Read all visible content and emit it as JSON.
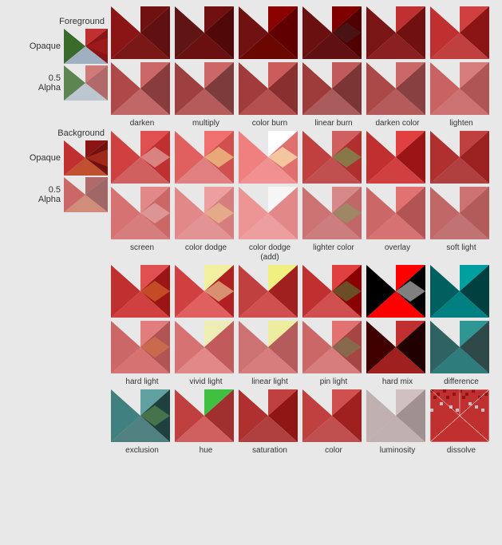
{
  "labels": {
    "foreground": "Foreground",
    "background": "Background",
    "opaque": "Opaque",
    "alpha": "0.5\nAlpha"
  },
  "row1": {
    "blends": [
      {
        "label": "darken"
      },
      {
        "label": "multiply"
      },
      {
        "label": "color burn"
      },
      {
        "label": "linear burn"
      },
      {
        "label": "darken color"
      },
      {
        "label": "lighten"
      }
    ]
  },
  "row2": {
    "blends": [
      {
        "label": "screen"
      },
      {
        "label": "color dodge"
      },
      {
        "label": "color dodge\n(add)"
      },
      {
        "label": "lighter color"
      },
      {
        "label": "overlay"
      },
      {
        "label": "soft light"
      }
    ]
  },
  "row3": {
    "blends": [
      {
        "label": "hard light"
      },
      {
        "label": "vivid light"
      },
      {
        "label": "linear light"
      },
      {
        "label": "pin light"
      },
      {
        "label": "hard mix"
      },
      {
        "label": "difference"
      }
    ]
  },
  "row4": {
    "blends": [
      {
        "label": "exclusion"
      },
      {
        "label": "hue"
      },
      {
        "label": "saturation"
      },
      {
        "label": "color"
      },
      {
        "label": "luminosity"
      },
      {
        "label": "dissolve"
      }
    ]
  }
}
